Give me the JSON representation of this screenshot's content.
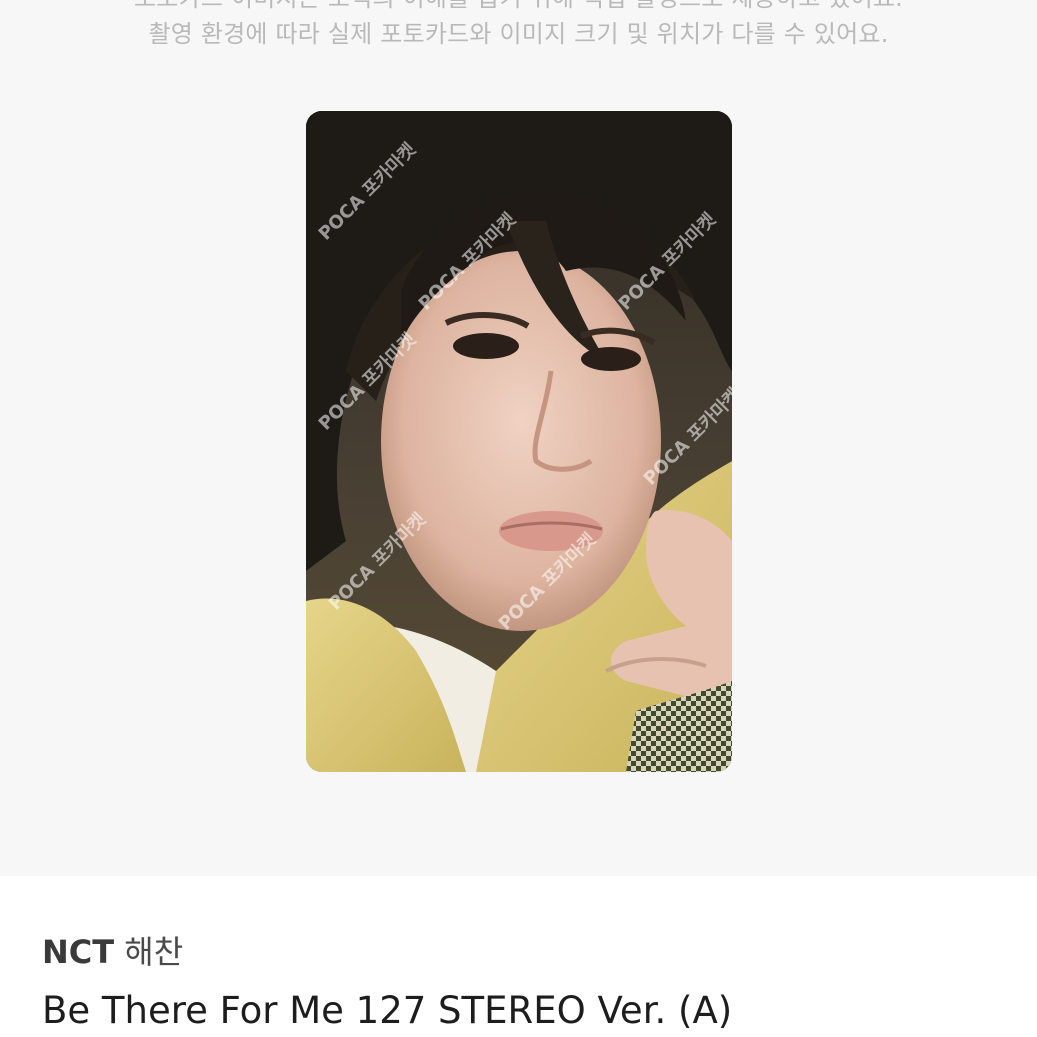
{
  "notice": {
    "line1": "포토카드 이미지는 보석의 이해를 돕기 위해 직접 촬영으로 제공하고 있어요.",
    "line2": "촬영 환경에 따라 실제 포토카드와 이미지 크기 및 위치가 다를 수 있어요."
  },
  "photocard": {
    "alt": "NCT 해찬 photocard",
    "watermark": "POCA 포카마켓"
  },
  "product": {
    "group": "NCT",
    "member": "해찬",
    "title": "Be There For Me 127 STEREO Ver. (A)"
  }
}
